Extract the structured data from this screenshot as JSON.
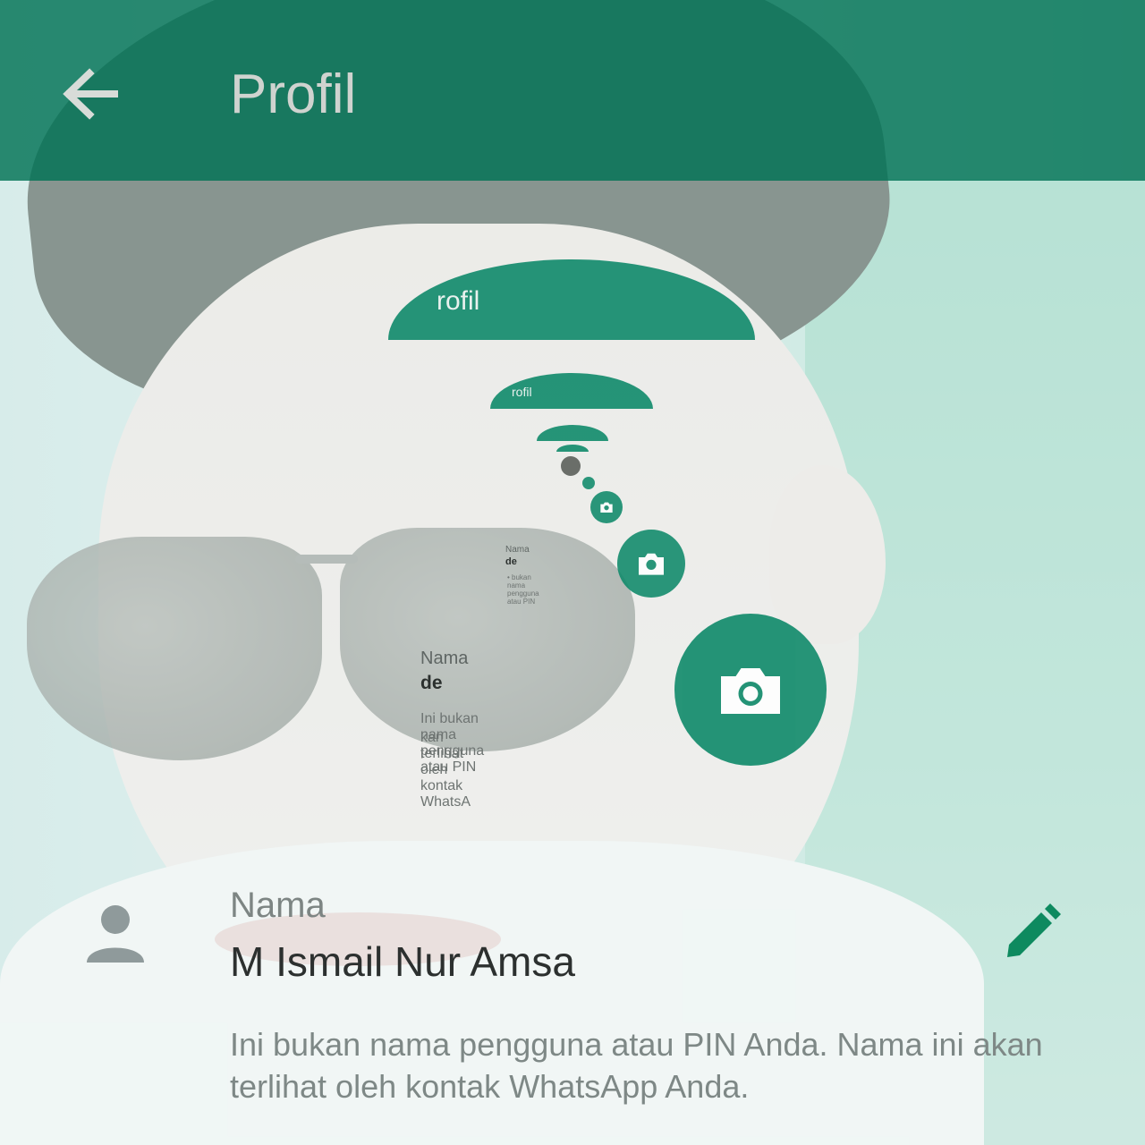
{
  "header": {
    "title": "Profil",
    "back_icon": "arrow-left-icon"
  },
  "preview": {
    "arc1_text": "rofil",
    "arc2_text": "rofil",
    "mini_label": "Nama",
    "mini_name": "de",
    "mini_hint_line1": "Ini bukan nama pengguna atau PIN",
    "mini_hint_line2": "kan terlihat oleh kontak WhatsA",
    "tiny_label": "Nama",
    "tiny_name": "de",
    "tiny_hint": "• bukan nama pengguna atau PIN",
    "camera_icon": "camera-icon"
  },
  "profile": {
    "name_label": "Nama",
    "name_value": "M Ismail Nur Amsa",
    "hint": "Ini bukan nama pengguna atau PIN Anda. Nama ini akan terlihat oleh kontak WhatsApp Anda.",
    "person_icon": "person-icon",
    "edit_icon": "pencil-icon"
  },
  "colors": {
    "appbar": "#007254",
    "accent": "#0f8a6a",
    "edit_icon": "#0e8a5f"
  }
}
